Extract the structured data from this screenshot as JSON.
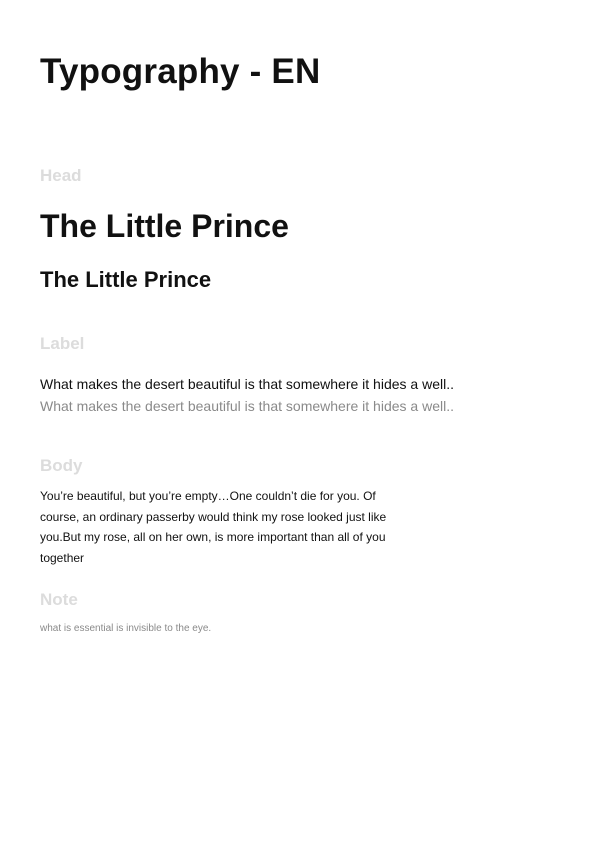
{
  "title": "Typography - EN",
  "sections": {
    "head": {
      "label": "Head",
      "large": "The Little Prince",
      "medium": "The Little Prince"
    },
    "label": {
      "label": "Label",
      "dark": "What makes the desert beautiful is that somewhere it hides a well..",
      "light": "What makes the desert beautiful is that somewhere it hides a well.."
    },
    "body": {
      "label": "Body",
      "text": "You’re beautiful, but you’re empty…One couldn’t die for you. Of course, an ordinary passerby would think my rose looked just like you.But my rose, all on her own, is more important than all of you together"
    },
    "note": {
      "label": "Note",
      "text": "what is essential is invisible to the eye."
    }
  }
}
